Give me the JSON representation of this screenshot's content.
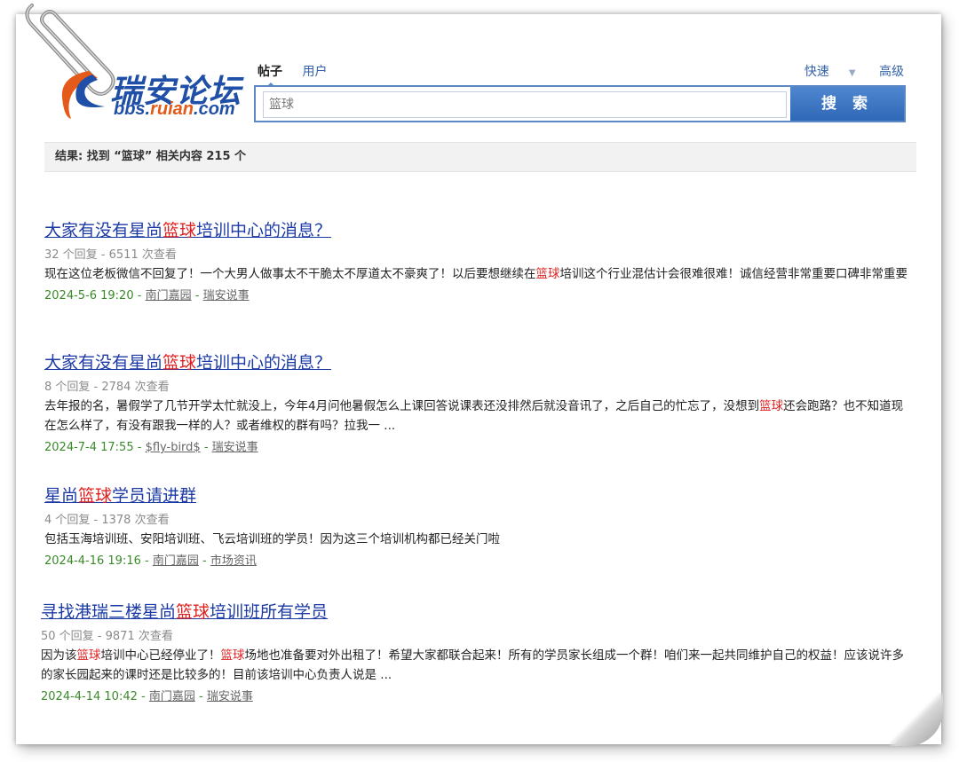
{
  "logo": {
    "name_cn": "瑞安论坛",
    "url_pre": "bbs.",
    "url_mid": "ruian",
    "url_post": ".com",
    "colors": {
      "blue": "#1f4fa6",
      "orange": "#e35a1a"
    }
  },
  "tabs": [
    {
      "label": "帖子",
      "active": true
    },
    {
      "label": "用户",
      "active": false
    }
  ],
  "links": {
    "quick": "快速",
    "advanced": "高级"
  },
  "search": {
    "value": "篮球",
    "button": "搜 索"
  },
  "result_summary": "结果: 找到 “篮球” 相关内容 215 个",
  "keyword": "篮球",
  "results": [
    {
      "title_pre": "大家有没有星尚",
      "title_hl": "篮球",
      "title_post": "培训中心的消息？",
      "meta": "32 个回复 - 6511 次查看",
      "desc_pre": "现在这位老板微信不回复了！一个大男人做事太不干脆太不厚道太不豪爽了！以后要想继续在",
      "desc_hl": "篮球",
      "desc_post": "培训这个行业混估计会很难很难！诚信经营非常重要口碑非常重要",
      "date": "2024-5-6 19:20",
      "author": "南门嘉园",
      "forum": "瑞安说事"
    },
    {
      "title_pre": "大家有没有星尚",
      "title_hl": "篮球",
      "title_post": "培训中心的消息？",
      "meta": "8 个回复 - 2784 次查看",
      "desc_pre": "去年报的名，暑假学了几节开学太忙就没上，今年4月问他暑假怎么上课回答说课表还没排然后就没音讯了，之后自己的忙忘了，没想到",
      "desc_hl": "篮球",
      "desc_post": "还会跑路？也不知道现在怎么样了，有没有跟我一样的人？或者维权的群有吗？拉我一 ...",
      "date": "2024-7-4 17:55",
      "author": "$fly-bird$",
      "forum": "瑞安说事"
    },
    {
      "title_pre": "星尚",
      "title_hl": "篮球",
      "title_post": "学员请进群",
      "meta": "4 个回复 - 1378 次查看",
      "desc_pre": "包括玉海培训班、安阳培训班、飞云培训班的学员！因为这三个培训机构都已经关门啦",
      "desc_hl": "",
      "desc_post": "",
      "date": "2024-4-16 19:16",
      "author": "南门嘉园",
      "forum": "市场资讯"
    },
    {
      "title_pre": "寻找港瑞三楼星尚",
      "title_hl": "篮球",
      "title_post": "培训班所有学员",
      "meta": "50 个回复 - 9871 次查看",
      "desc_pre": "因为该",
      "desc_hl": "篮球",
      "desc_mid": "培训中心已经停业了！",
      "desc_hl2": "篮球",
      "desc_post": "场地也准备要对外出租了！希望大家都联合起来！所有的学员家长组成一个群！咱们来一起共同维护自己的权益！应该说许多的家长园起来的课时还是比较多的！目前该培训中心负责人说是 ...",
      "date": "2024-4-14 10:42",
      "author": "南门嘉园",
      "forum": "瑞安说事"
    }
  ]
}
